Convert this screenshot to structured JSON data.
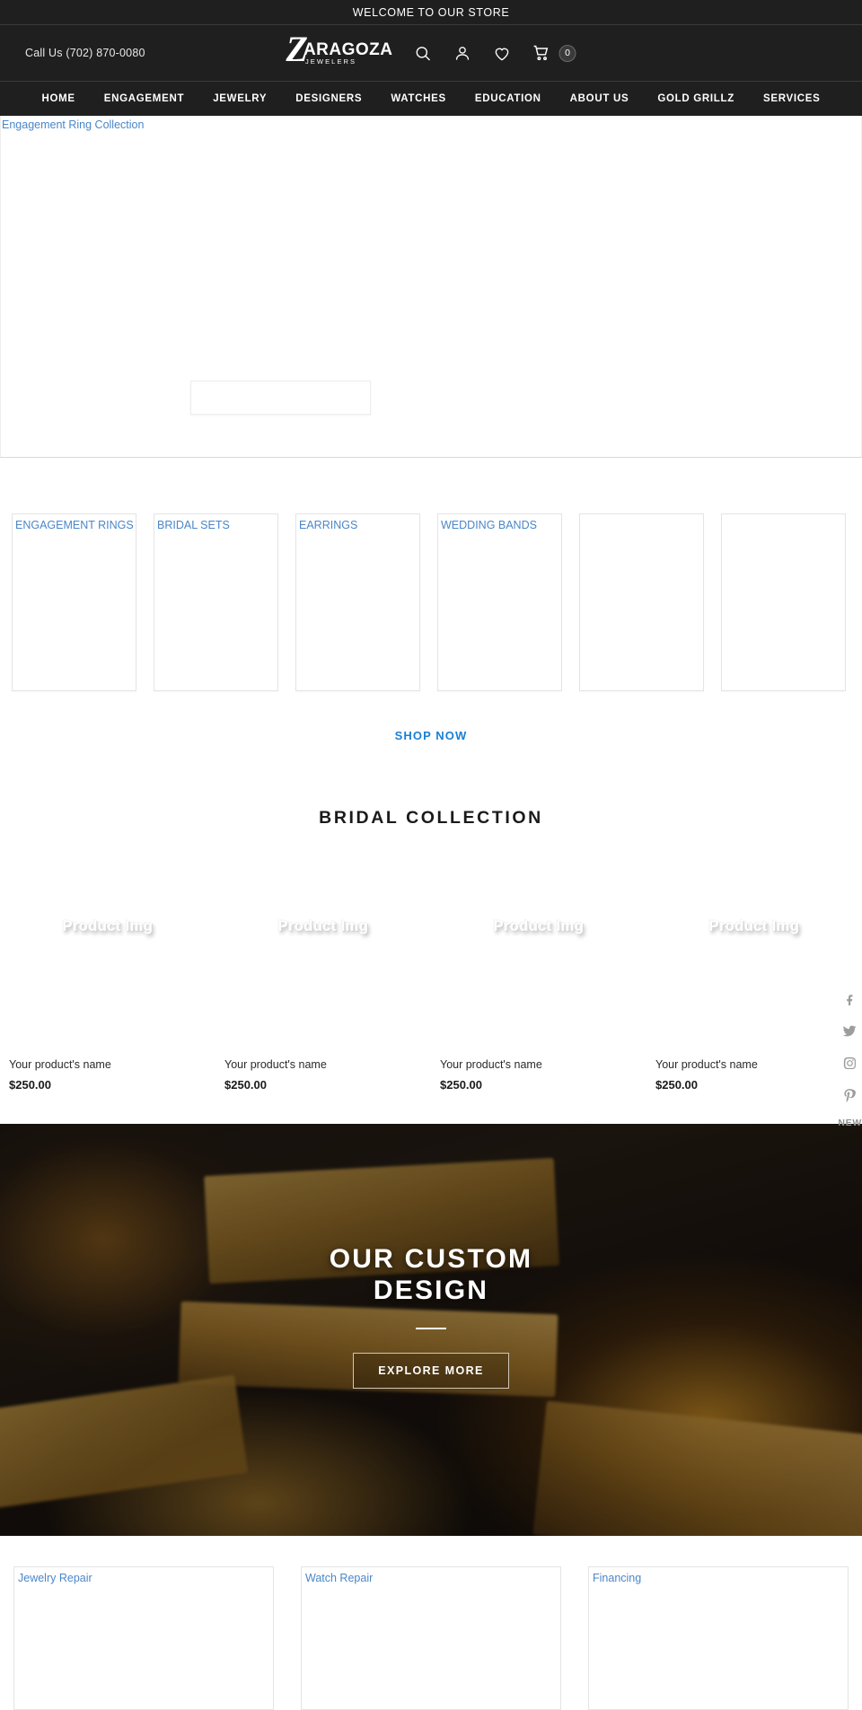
{
  "announce": {
    "text": "WELCOME TO OUR STORE"
  },
  "header": {
    "phone": "Call Us (702) 870-0080",
    "logo": {
      "initial": "Z",
      "main": "ARAGOZA",
      "sub": "JEWELERS"
    },
    "icons": {
      "search": "search-icon",
      "account": "user-icon",
      "wishlist": "heart-icon",
      "cart": "cart-icon"
    },
    "cart_count": "0"
  },
  "nav": {
    "items": [
      {
        "label": "HOME"
      },
      {
        "label": "ENGAGEMENT"
      },
      {
        "label": "JEWELRY"
      },
      {
        "label": "DESIGNERS"
      },
      {
        "label": "WATCHES"
      },
      {
        "label": "EDUCATION"
      },
      {
        "label": "ABOUT US"
      },
      {
        "label": "GOLD GRILLZ"
      },
      {
        "label": "SERVICES"
      }
    ]
  },
  "hero": {
    "alt_text": "Engagement Ring Collection"
  },
  "categories": {
    "tiles": [
      {
        "alt_text": "ENGAGEMENT RINGS"
      },
      {
        "alt_text": "BRIDAL SETS"
      },
      {
        "alt_text": "EARRINGS"
      },
      {
        "alt_text": "WEDDING BANDS"
      },
      {
        "alt_text": ""
      },
      {
        "alt_text": ""
      }
    ],
    "shop_now": "SHOP NOW"
  },
  "bridal": {
    "title": "BRIDAL COLLECTION",
    "products": [
      {
        "image_label": "Product Img",
        "name": "Your product's name",
        "price": "$250.00"
      },
      {
        "image_label": "Product Img",
        "name": "Your product's name",
        "price": "$250.00"
      },
      {
        "image_label": "Product Img",
        "name": "Your product's name",
        "price": "$250.00"
      },
      {
        "image_label": "Product Img",
        "name": "Your product's name",
        "price": "$250.00"
      }
    ]
  },
  "social": {
    "items": [
      {
        "name": "facebook-icon",
        "glyph": "f"
      },
      {
        "name": "twitter-icon",
        "glyph": ""
      },
      {
        "name": "instagram-icon",
        "glyph": ""
      },
      {
        "name": "pinterest-icon",
        "glyph": ""
      }
    ],
    "newsletter_tab": "NEW"
  },
  "custom_design": {
    "title_line1": "OUR CUSTOM",
    "title_line2": "DESIGN",
    "button": "EXPLORE MORE"
  },
  "services": {
    "cards": [
      {
        "alt_text": "Jewelry Repair"
      },
      {
        "alt_text": "Watch Repair"
      },
      {
        "alt_text": "Financing"
      }
    ]
  },
  "colors": {
    "header_bg": "#201f1f",
    "broken_alt": "#4a86c8",
    "link_blue": "#1a7fd4",
    "text_dark": "#1a1a1a"
  }
}
